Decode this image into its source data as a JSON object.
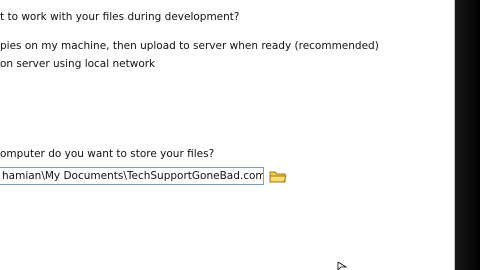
{
  "dialog": {
    "question_storage_mode": "t to work with your files during development?",
    "option_local_copies": "pies on my machine, then upload to server when ready (recommended)",
    "option_network": "on server using local network",
    "question_location": "omputer do you want to store your files?",
    "path_value": "hamian\\My Documents\\TechSupportGoneBad.com\\",
    "browse_icon": "folder-icon",
    "colors": {
      "folder_yellow": "#f2cc4a",
      "field_border": "#7f9db9",
      "window_edge": "#000000"
    }
  }
}
